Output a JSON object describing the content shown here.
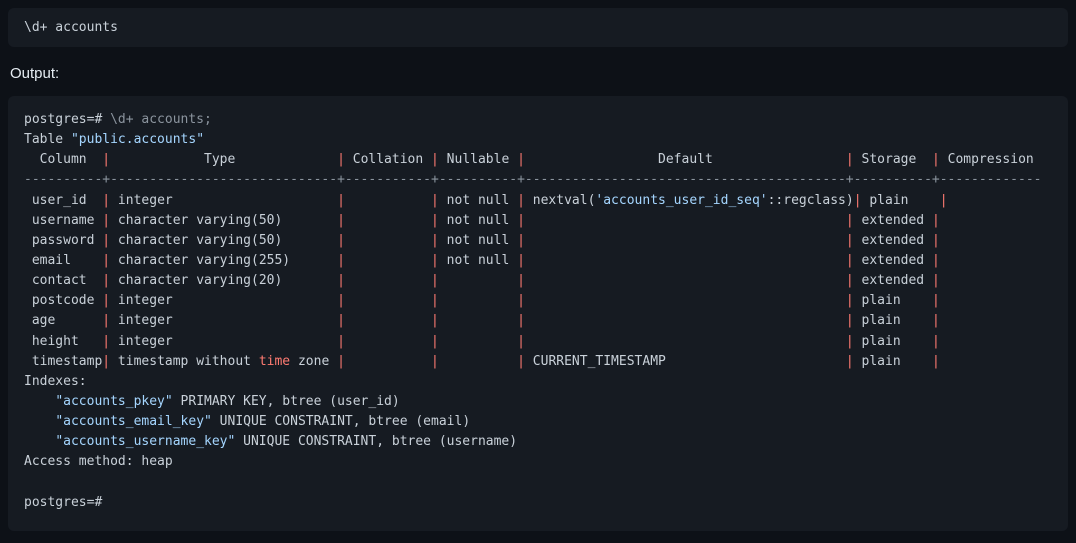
{
  "command": {
    "text": "\\d+ accounts"
  },
  "outputLabel": "Output:",
  "prompt1": "postgres=# ",
  "prompt1cmd": "\\d+ accounts;",
  "tableTitlePrefix": "Table ",
  "tableTitleName": "\"public.accounts\"",
  "headers": {
    "col": "Column",
    "type": "Type",
    "collation": "Collation",
    "nullable": "Nullable",
    "default": "Default",
    "storage": "Storage",
    "compression": "Compression"
  },
  "rows": [
    {
      "col": "user_id",
      "type": "integer",
      "nullable": "not null",
      "default_pre": "nextval(",
      "default_str": "'accounts_user_id_seq'",
      "default_post": "::regclass)",
      "storage": "plain"
    },
    {
      "col": "username",
      "type": "character varying(50)",
      "nullable": "not null",
      "default_pre": "",
      "default_str": "",
      "default_post": "",
      "storage": "extended"
    },
    {
      "col": "password",
      "type": "character varying(50)",
      "nullable": "not null",
      "default_pre": "",
      "default_str": "",
      "default_post": "",
      "storage": "extended"
    },
    {
      "col": "email",
      "type": "character varying(255)",
      "nullable": "not null",
      "default_pre": "",
      "default_str": "",
      "default_post": "",
      "storage": "extended"
    },
    {
      "col": "contact",
      "type": "character varying(20)",
      "nullable": "",
      "default_pre": "",
      "default_str": "",
      "default_post": "",
      "storage": "extended"
    },
    {
      "col": "postcode",
      "type": "integer",
      "nullable": "",
      "default_pre": "",
      "default_str": "",
      "default_post": "",
      "storage": "plain"
    },
    {
      "col": "age",
      "type": "integer",
      "nullable": "",
      "default_pre": "",
      "default_str": "",
      "default_post": "",
      "storage": "plain"
    },
    {
      "col": "height",
      "type": "integer",
      "nullable": "",
      "default_pre": "",
      "default_str": "",
      "default_post": "",
      "storage": "plain"
    }
  ],
  "tsRow": {
    "col": "timestamp",
    "type_pre": "timestamp without ",
    "type_kw": "time",
    "type_post": " zone",
    "nullable": "",
    "default": "CURRENT_TIMESTAMP",
    "storage": "plain"
  },
  "indexesLabel": "Indexes:",
  "indexes": [
    {
      "name": "\"accounts_pkey\"",
      "rest": " PRIMARY KEY, btree (user_id)"
    },
    {
      "name": "\"accounts_email_key\"",
      "rest": " UNIQUE CONSTRAINT, btree (email)"
    },
    {
      "name": "\"accounts_username_key\"",
      "rest": " UNIQUE CONSTRAINT, btree (username)"
    }
  ],
  "accessMethod": "Access method: heap",
  "prompt2": "postgres=#",
  "widths": {
    "col": 10,
    "type": 29,
    "collation": 11,
    "nullable": 10,
    "default": 41,
    "storage": 10,
    "compression": 13
  }
}
